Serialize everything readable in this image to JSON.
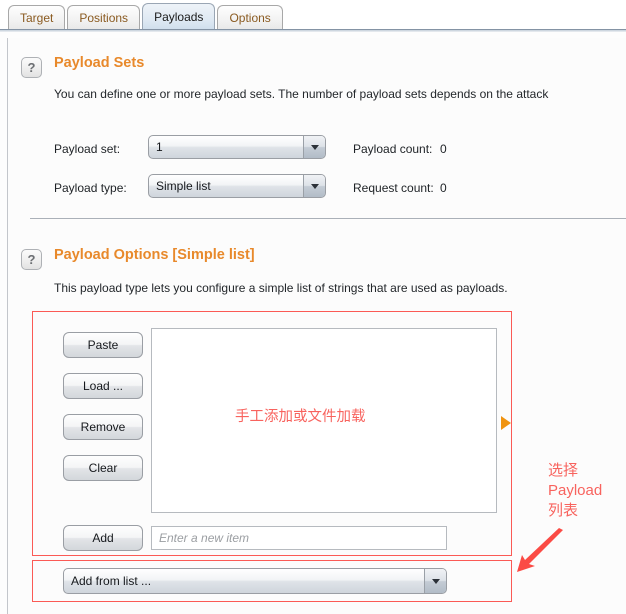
{
  "window": {
    "tabs": [
      {
        "label": "Target",
        "active": false
      },
      {
        "label": "Positions",
        "active": false
      },
      {
        "label": "Payloads",
        "active": true
      },
      {
        "label": "Options",
        "active": false
      }
    ]
  },
  "payload_sets": {
    "help_icon": "question-mark-icon",
    "title": "Payload Sets",
    "description": "You can define one or more payload sets. The number of payload sets depends on the attack",
    "payload_set_label": "Payload set:",
    "payload_set_value": "1",
    "payload_type_label": "Payload type:",
    "payload_type_value": "Simple list",
    "payload_count_label": "Payload count:",
    "payload_count_value": "0",
    "request_count_label": "Request count:",
    "request_count_value": "0"
  },
  "payload_options": {
    "help_icon": "question-mark-icon",
    "title": "Payload Options [Simple list]",
    "description": "This payload type lets you configure a simple list of strings that are used as payloads.",
    "buttons": [
      {
        "label": "Paste"
      },
      {
        "label": "Load ..."
      },
      {
        "label": "Remove"
      },
      {
        "label": "Clear"
      }
    ],
    "add_button_label": "Add",
    "new_item_placeholder": "Enter a new item",
    "add_from_list_value": "Add from list ...",
    "list_items": [],
    "expand_marker_icon": "triangle-right-icon"
  },
  "annotations": {
    "list_note": "手工添加或文件加载",
    "side_note_line1": "选择",
    "side_note_line2": "Payload",
    "side_note_line3": "列表",
    "arrow_icon": "arrow-down-left-icon"
  },
  "colors": {
    "accent_orange": "#e8892b",
    "annotation_red": "#f8635e",
    "marker_orange": "#f0930f",
    "tab_inactive_text": "#8a5a20"
  }
}
